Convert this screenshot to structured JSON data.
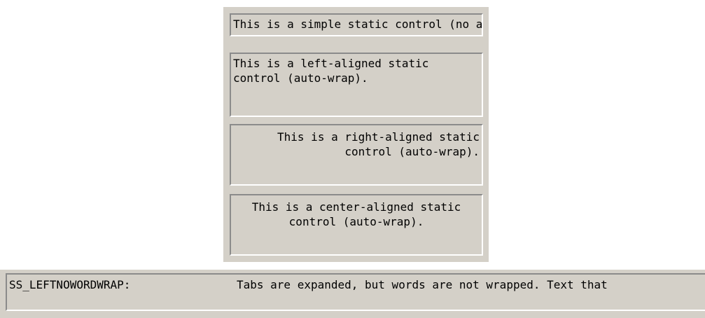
{
  "statics": {
    "simple_text": "This is a simple static control (no auto-wrap).",
    "left_text": "This is a left-aligned static control (auto-wrap).",
    "right_text": "This is a right-aligned static control (auto-wrap).",
    "center_text": "This is a center-aligned static control (auto-wrap)."
  },
  "nowrap": {
    "label": "SS_LEFTNOWORDWRAP:",
    "text": "Tabs are expanded, but words are not wrapped. Text that"
  },
  "colors": {
    "face": "#d4d0c8",
    "shadow": "#8b8b8b",
    "highlight": "#ffffff",
    "text": "#000000"
  }
}
